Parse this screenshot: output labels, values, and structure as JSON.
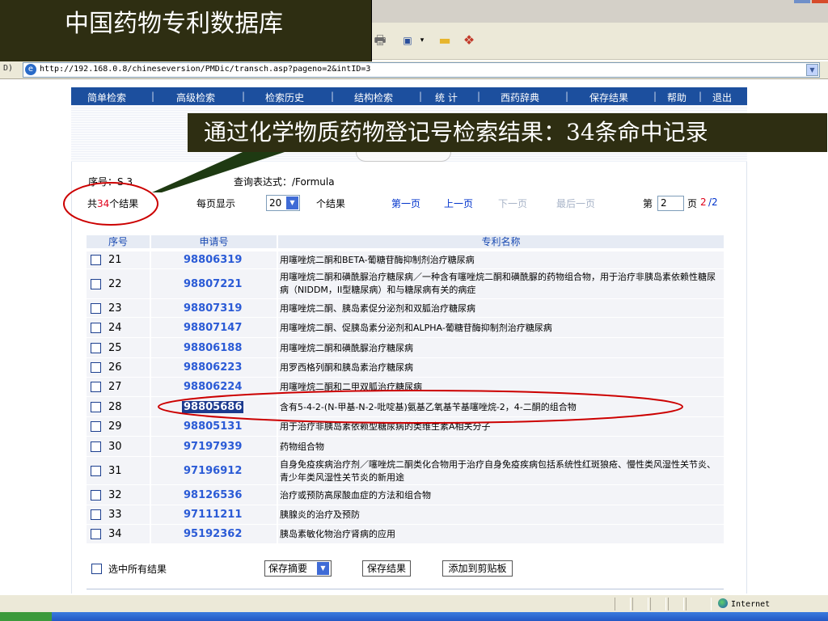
{
  "slide_title": "中国药物专利数据库",
  "callout_text": "通过化学物质药物登记号检索结果：34条命中记录",
  "browser": {
    "address_label": "D)",
    "url": "http://192.168.0.8/chineseversion/PMDic/transch.asp?pageno=2&intID=3",
    "status_zone": "Internet"
  },
  "nav": {
    "items": [
      "简单检索",
      "高级检索",
      "检索历史",
      "结构检索",
      "统 计",
      "西药辞典",
      "保存结果",
      "帮助",
      "退出"
    ],
    "separator": "|"
  },
  "query": {
    "seq_label": "序号：S 3",
    "expr_label": "查询表达式：",
    "expr_value": "/Formula"
  },
  "results": {
    "total_prefix": "共",
    "total": "34",
    "total_suffix": "个结果",
    "per_page_label": "每页显示",
    "per_page_value": "20",
    "per_page_suffix": "个结果",
    "first": "第一页",
    "prev": "上一页",
    "next": "下一页",
    "last": "最后一页",
    "page_prefix": "第",
    "page_value": "2",
    "page_suffix": "页",
    "page_current": "2",
    "page_total": "/2"
  },
  "table": {
    "headers": [
      "序号",
      "申请号",
      "专利名称"
    ],
    "rows": [
      {
        "seq": "21",
        "appno": "98806319",
        "name": "用噻唑烷二酮和BETA-葡糖苷酶抑制剂治疗糖尿病"
      },
      {
        "seq": "22",
        "appno": "98807221",
        "name": "用噻唑烷二酮和磺酰脲治疗糖尿病／一种含有噻唑烷二酮和磺酰脲的药物组合物，用于治疗非胰岛素依赖性糖尿病（NIDDM，II型糖尿病）和与糖尿病有关的病症"
      },
      {
        "seq": "23",
        "appno": "98807319",
        "name": "用噻唑烷二酮、胰岛素促分泌剂和双胍治疗糖尿病"
      },
      {
        "seq": "24",
        "appno": "98807147",
        "name": "用噻唑烷二酮、促胰岛素分泌剂和ALPHA-葡糖苷酶抑制剂治疗糖尿病"
      },
      {
        "seq": "25",
        "appno": "98806188",
        "name": "用噻唑烷二酮和磺酰脲治疗糖尿病"
      },
      {
        "seq": "26",
        "appno": "98806223",
        "name": "用罗西格列酮和胰岛素治疗糖尿病"
      },
      {
        "seq": "27",
        "appno": "98806224",
        "name": "用噻唑烷二酮和二甲双胍治疗糖尿病"
      },
      {
        "seq": "28",
        "appno": "98805686",
        "name": "含有5-4-2-(N-甲基-N-2-吡啶基)氨基乙氧基苄基噻唑烷-2，4-二酮的组合物"
      },
      {
        "seq": "29",
        "appno": "98805131",
        "name": "用于治疗非胰岛素依赖型糖尿病的类维生素A相关分子"
      },
      {
        "seq": "30",
        "appno": "97197939",
        "name": "药物组合物"
      },
      {
        "seq": "31",
        "appno": "97196912",
        "name": "自身免疫疾病治疗剂／噻唑烷二酮类化合物用于治疗自身免疫疾病包括系统性红斑狼疮、慢性类风湿性关节炎、青少年类风湿性关节炎的新用途"
      },
      {
        "seq": "32",
        "appno": "98126536",
        "name": "治疗或预防高尿酸血症的方法和组合物"
      },
      {
        "seq": "33",
        "appno": "97111211",
        "name": "胰腺炎的治疗及预防"
      },
      {
        "seq": "34",
        "appno": "95192362",
        "name": "胰岛素敏化物治疗肾病的应用"
      }
    ]
  },
  "bottom": {
    "select_all": "选中所有结果",
    "save_format": "保存摘要",
    "save_button": "保存结果",
    "clipboard_button": "添加到剪贴板"
  },
  "colors": {
    "nav_bg": "#1c4f9e",
    "title_bg": "#2e2e12",
    "annotation_red": "#cc0000",
    "link_blue": "#2b5bd6"
  }
}
